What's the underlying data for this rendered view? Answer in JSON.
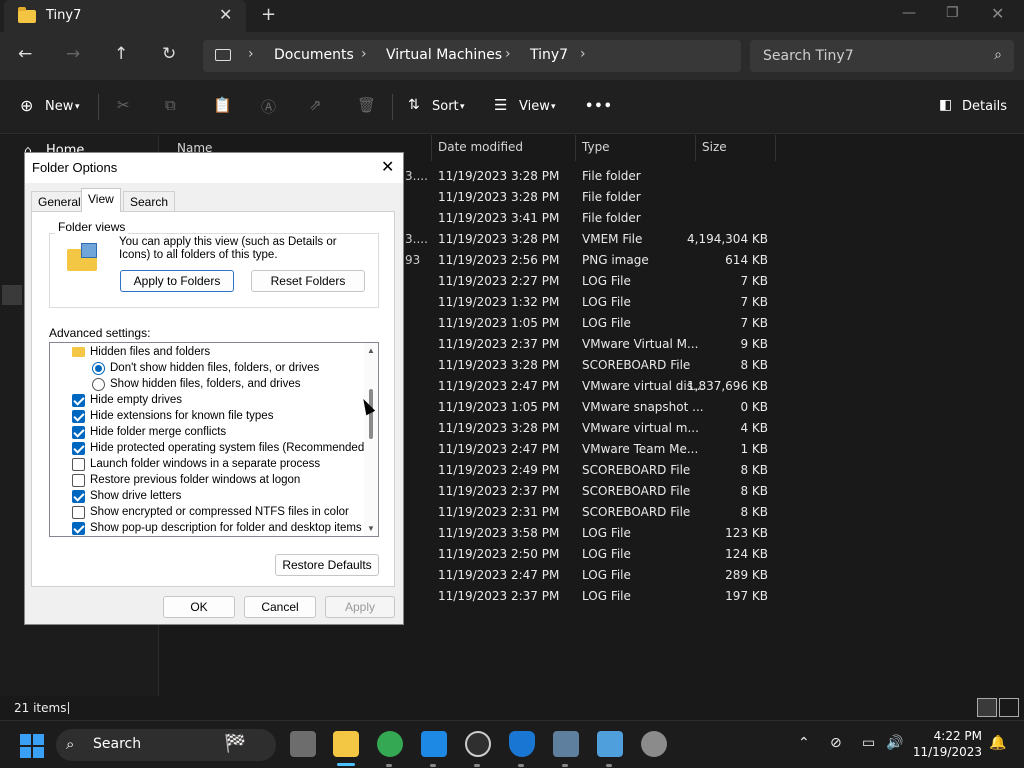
{
  "window": {
    "tab_title": "Tiny7",
    "icons": {
      "tab": "folder-icon",
      "close": "close-icon",
      "new_tab": "plus-icon",
      "minimize": "minimize-icon",
      "maximize": "maximize-icon",
      "window_close": "close-icon"
    }
  },
  "nav": {
    "breadcrumbs": [
      "Documents",
      "Virtual Machines",
      "Tiny7"
    ],
    "search_placeholder": "Search Tiny7",
    "icons": [
      "back-arrow-icon",
      "forward-arrow-icon",
      "up-arrow-icon",
      "refresh-icon",
      "this-pc-icon",
      "search-icon"
    ]
  },
  "commands": {
    "new_label": "New",
    "sort_label": "Sort",
    "view_label": "View",
    "details_label": "Details",
    "more_label": "•••"
  },
  "sidebar": {
    "home_label": "Home"
  },
  "columns": {
    "name": "Name",
    "date": "Date modified",
    "type": "Type",
    "size": "Size"
  },
  "files": [
    {
      "name": "3....",
      "date": "11/19/2023 3:28 PM",
      "type": "File folder",
      "size": ""
    },
    {
      "name": "",
      "date": "11/19/2023 3:28 PM",
      "type": "File folder",
      "size": ""
    },
    {
      "name": "",
      "date": "11/19/2023 3:41 PM",
      "type": "File folder",
      "size": ""
    },
    {
      "name": "3....",
      "date": "11/19/2023 3:28 PM",
      "type": "VMEM File",
      "size": "4,194,304 KB"
    },
    {
      "name": "93",
      "date": "11/19/2023 2:56 PM",
      "type": "PNG image",
      "size": "614 KB"
    },
    {
      "name": "",
      "date": "11/19/2023 2:27 PM",
      "type": "LOG File",
      "size": "7 KB"
    },
    {
      "name": "",
      "date": "11/19/2023 1:32 PM",
      "type": "LOG File",
      "size": "7 KB"
    },
    {
      "name": "",
      "date": "11/19/2023 1:05 PM",
      "type": "LOG File",
      "size": "7 KB"
    },
    {
      "name": "",
      "date": "11/19/2023 2:37 PM",
      "type": "VMware Virtual M...",
      "size": "9 KB"
    },
    {
      "name": "",
      "date": "11/19/2023 3:28 PM",
      "type": "SCOREBOARD File",
      "size": "8 KB"
    },
    {
      "name": "",
      "date": "11/19/2023 2:47 PM",
      "type": "VMware virtual dis...",
      "size": "1,837,696 KB"
    },
    {
      "name": "",
      "date": "11/19/2023 1:05 PM",
      "type": "VMware snapshot ...",
      "size": "0 KB"
    },
    {
      "name": "",
      "date": "11/19/2023 3:28 PM",
      "type": "VMware virtual m...",
      "size": "4 KB"
    },
    {
      "name": "",
      "date": "11/19/2023 2:47 PM",
      "type": "VMware Team Me...",
      "size": "1 KB"
    },
    {
      "name": "",
      "date": "11/19/2023 2:49 PM",
      "type": "SCOREBOARD File",
      "size": "8 KB"
    },
    {
      "name": "",
      "date": "11/19/2023 2:37 PM",
      "type": "SCOREBOARD File",
      "size": "8 KB"
    },
    {
      "name": "",
      "date": "11/19/2023 2:31 PM",
      "type": "SCOREBOARD File",
      "size": "8 KB"
    },
    {
      "name": "",
      "date": "11/19/2023 3:58 PM",
      "type": "LOG File",
      "size": "123 KB"
    },
    {
      "name": "",
      "date": "11/19/2023 2:50 PM",
      "type": "LOG File",
      "size": "124 KB"
    },
    {
      "name": "",
      "date": "11/19/2023 2:47 PM",
      "type": "LOG File",
      "size": "289 KB"
    },
    {
      "name": "",
      "date": "11/19/2023 2:37 PM",
      "type": "LOG File",
      "size": "197 KB"
    }
  ],
  "status": {
    "item_count": "21 items"
  },
  "taskbar": {
    "search_label": "Search",
    "time": "4:22 PM",
    "date": "11/19/2023"
  },
  "dialog": {
    "title": "Folder Options",
    "tabs": [
      "General",
      "View",
      "Search"
    ],
    "folder_views_label": "Folder views",
    "folder_views_desc": "You can apply this view (such as Details or Icons) to all folders of this type.",
    "apply_to_folders": "Apply to Folders",
    "reset_folders": "Reset Folders",
    "advanced_label": "Advanced settings:",
    "settings": [
      {
        "kind": "folder",
        "label": "Hidden files and folders",
        "checked": false
      },
      {
        "kind": "radio",
        "label": "Don't show hidden files, folders, or drives",
        "checked": true
      },
      {
        "kind": "radio",
        "label": "Show hidden files, folders, and drives",
        "checked": false
      },
      {
        "kind": "check",
        "label": "Hide empty drives",
        "checked": true
      },
      {
        "kind": "check",
        "label": "Hide extensions for known file types",
        "checked": true
      },
      {
        "kind": "check",
        "label": "Hide folder merge conflicts",
        "checked": true
      },
      {
        "kind": "check",
        "label": "Hide protected operating system files (Recommended)",
        "checked": true
      },
      {
        "kind": "check",
        "label": "Launch folder windows in a separate process",
        "checked": false
      },
      {
        "kind": "check",
        "label": "Restore previous folder windows at logon",
        "checked": false
      },
      {
        "kind": "check",
        "label": "Show drive letters",
        "checked": true
      },
      {
        "kind": "check",
        "label": "Show encrypted or compressed NTFS files in color",
        "checked": false
      },
      {
        "kind": "check",
        "label": "Show pop-up description for folder and desktop items",
        "checked": true
      }
    ],
    "restore_defaults": "Restore Defaults",
    "ok": "OK",
    "cancel": "Cancel",
    "apply": "Apply"
  },
  "colors": {
    "accent": "#0067c0",
    "folder": "#f3c643",
    "taskbar_active": "#4cc2ff"
  }
}
